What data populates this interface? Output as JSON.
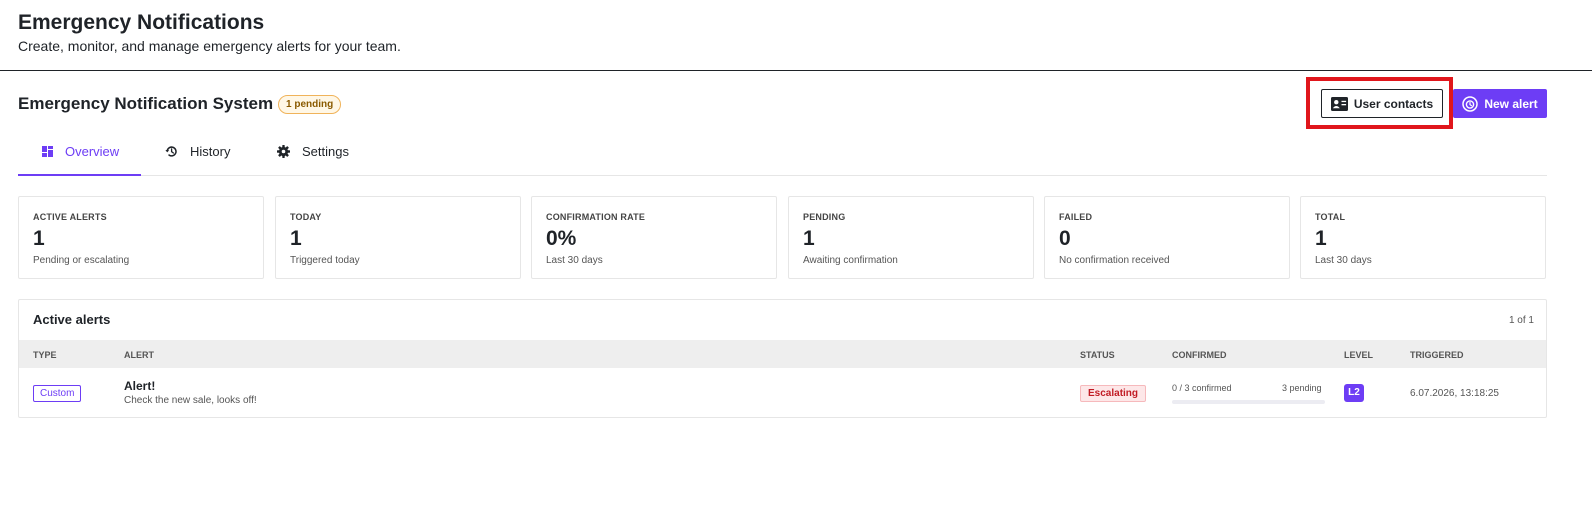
{
  "header": {
    "title": "Emergency Notifications",
    "subtitle": "Create, monitor, and manage emergency alerts for your team."
  },
  "system": {
    "title": "Emergency Notification System",
    "pending_badge": "1 pending"
  },
  "actions": {
    "user_contacts_label": "User contacts",
    "user_contacts_icon": "contact-card-icon",
    "new_alert_label": "New alert",
    "new_alert_icon": "alarm-icon"
  },
  "tabs": [
    {
      "label": "Overview",
      "icon": "dashboard-icon",
      "active": true
    },
    {
      "label": "History",
      "icon": "history-icon",
      "active": false
    },
    {
      "label": "Settings",
      "icon": "gear-icon",
      "active": false
    }
  ],
  "stats": [
    {
      "label": "ACTIVE ALERTS",
      "value": "1",
      "caption": "Pending or escalating"
    },
    {
      "label": "TODAY",
      "value": "1",
      "caption": "Triggered today"
    },
    {
      "label": "CONFIRMATION RATE",
      "value": "0%",
      "caption": "Last 30 days"
    },
    {
      "label": "PENDING",
      "value": "1",
      "caption": "Awaiting confirmation"
    },
    {
      "label": "FAILED",
      "value": "0",
      "caption": "No confirmation received"
    },
    {
      "label": "TOTAL",
      "value": "1",
      "caption": "Last 30 days"
    }
  ],
  "alerts": {
    "title": "Active alerts",
    "count": "1 of 1",
    "columns": [
      "TYPE",
      "ALERT",
      "STATUS",
      "CONFIRMED",
      "LEVEL",
      "TRIGGERED"
    ],
    "rows": [
      {
        "type": "Custom",
        "name": "Alert!",
        "description": "Check the new sale, looks off!",
        "status": "Escalating",
        "confirmed": "0 / 3 confirmed",
        "pending": "3 pending",
        "confirmed_fraction": 0,
        "level": "L2",
        "triggered": "6.07.2026, 13:18:25"
      }
    ]
  },
  "colors": {
    "accent": "#6d3df5",
    "highlight": "#e0161c",
    "status_escalating": "#c11b24",
    "pending_badge": "#f0b35a"
  }
}
